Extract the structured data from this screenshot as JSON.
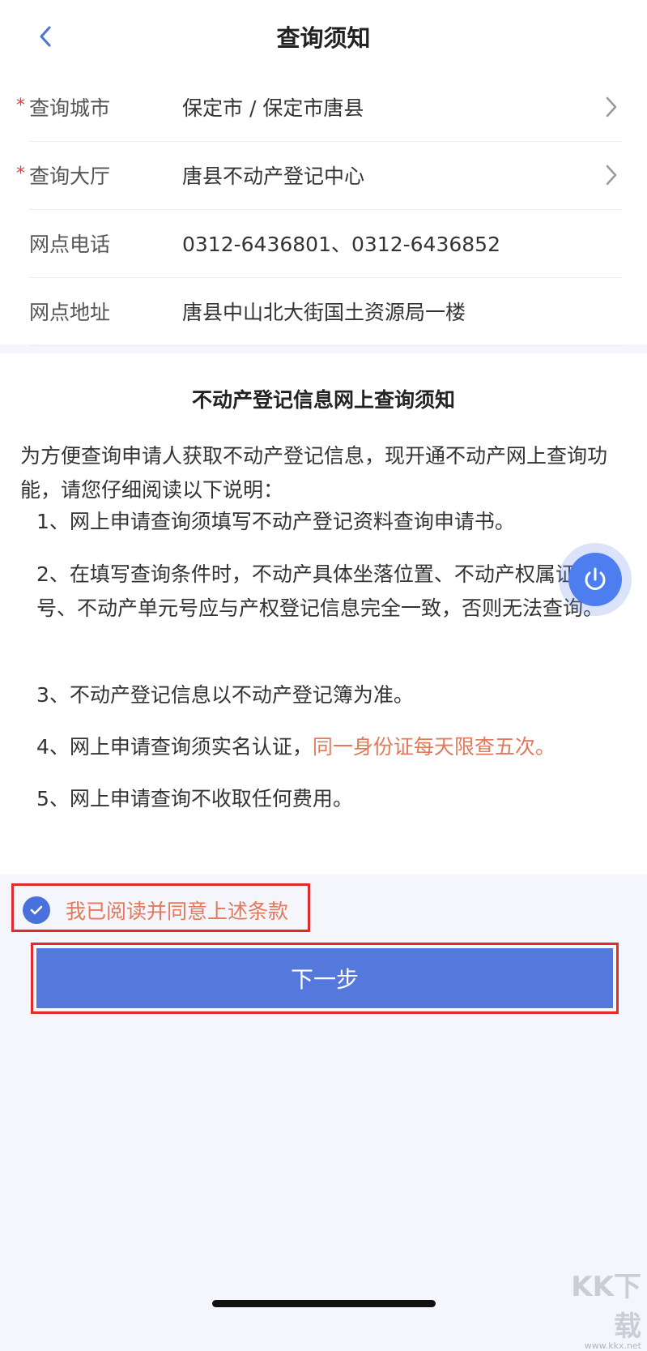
{
  "header": {
    "title": "查询须知",
    "back_icon": "chevron-left-icon"
  },
  "form": {
    "rows": [
      {
        "required": "*",
        "label": "查询城市",
        "value": "保定市 / 保定市唐县"
      },
      {
        "required": "*",
        "label": "查询大厅",
        "value": "唐县不动产登记中心"
      },
      {
        "label": "网点电话",
        "value": "0312-6436801、0312-6436852"
      },
      {
        "label": "网点地址",
        "value": "唐县中山北大街国土资源局一楼"
      }
    ]
  },
  "notice": {
    "title": "不动产登记信息网上查询须知",
    "intro": "为方便查询申请人获取不动产登记信息，现开通不动产网上查询功能，请您仔细阅读以下说明：",
    "items": [
      "1、网上申请查询须填写不动产登记资料查询申请书。",
      "2、在填写查询条件时，不动产具体坐落位置、不动产权属证书号、不动产单元号应与产权登记信息完全一致，否则无法查询。",
      "3、不动产登记信息以不动产登记簿为准。",
      "4、网上申请查询须实名认证，",
      "5、网上申请查询不收取任何费用。"
    ],
    "item4_highlight": "同一身份证每天限查五次。"
  },
  "agree": {
    "label": "我已阅读并同意上述条款",
    "checked": true
  },
  "next_button": {
    "label": "下一步"
  },
  "watermark": {
    "brand": "KK下载",
    "url": "www.kkx.net"
  },
  "colors": {
    "primary": "#5578dc",
    "accent_text": "#e2795b",
    "required": "#e23c3c",
    "highlight_box": "#e22b2b"
  }
}
